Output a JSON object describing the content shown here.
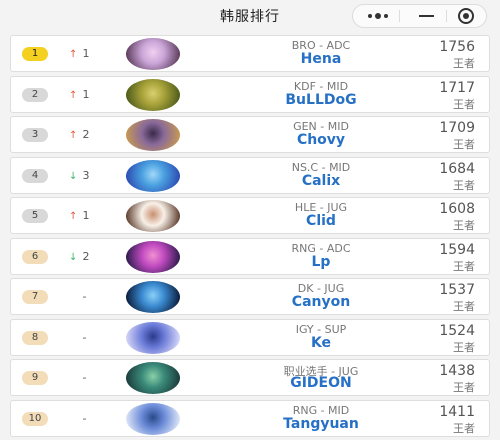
{
  "header": {
    "title": "韩服排行",
    "more_icon": "more-dots-icon",
    "minimize_icon": "minimize-icon",
    "close_icon": "target-close-icon"
  },
  "rows": [
    {
      "rank": "1",
      "rank_style": "gold",
      "trend": "up",
      "trend_value": "1",
      "team_role": "BRO - ADC",
      "name": "Hena",
      "score": "1756",
      "tier": "王者",
      "avatar_colors": [
        "#caa6d8",
        "#5a3a5a",
        "#f0d0f0"
      ]
    },
    {
      "rank": "2",
      "rank_style": "silver",
      "trend": "up",
      "trend_value": "1",
      "team_role": "KDF - MID",
      "name": "BuLLDoG",
      "score": "1717",
      "tier": "王者",
      "avatar_colors": [
        "#a8a23a",
        "#4b5a1a",
        "#d8d070"
      ]
    },
    {
      "rank": "3",
      "rank_style": "silver",
      "trend": "up",
      "trend_value": "2",
      "team_role": "GEN - MID",
      "name": "Chovy",
      "score": "1709",
      "tier": "王者",
      "avatar_colors": [
        "#8a6a9a",
        "#c89a50",
        "#3a2a4a"
      ]
    },
    {
      "rank": "4",
      "rank_style": "silver",
      "trend": "down",
      "trend_value": "3",
      "team_role": "NS.C - MID",
      "name": "Calix",
      "score": "1684",
      "tier": "王者",
      "avatar_colors": [
        "#4aa0e0",
        "#2a4ab0",
        "#a0d8f8"
      ]
    },
    {
      "rank": "5",
      "rank_style": "silver",
      "trend": "up",
      "trend_value": "1",
      "team_role": "HLE - JUG",
      "name": "Clid",
      "score": "1608",
      "tier": "王者",
      "avatar_colors": [
        "#f8f0e8",
        "#5a3a2a",
        "#c89070"
      ]
    },
    {
      "rank": "6",
      "rank_style": "bronze",
      "trend": "down",
      "trend_value": "2",
      "team_role": "RNG - ADC",
      "name": "Lp",
      "score": "1594",
      "tier": "王者",
      "avatar_colors": [
        "#c04ac0",
        "#2a1a4a",
        "#f090d0"
      ]
    },
    {
      "rank": "7",
      "rank_style": "bronze",
      "trend": "none",
      "trend_value": "-",
      "team_role": "DK - JUG",
      "name": "Canyon",
      "score": "1537",
      "tier": "王者",
      "avatar_colors": [
        "#3a8ad0",
        "#0a1a3a",
        "#8ad0f8"
      ]
    },
    {
      "rank": "8",
      "rank_style": "bronze",
      "trend": "none",
      "trend_value": "-",
      "team_role": "IGY - SUP",
      "name": "Ke",
      "score": "1524",
      "tier": "王者",
      "avatar_colors": [
        "#6a7ad8",
        "#d8d8f8",
        "#2a3a8a"
      ]
    },
    {
      "rank": "9",
      "rank_style": "bronze",
      "trend": "none",
      "trend_value": "-",
      "team_role": "职业选手 - JUG",
      "name": "GIDEON",
      "score": "1438",
      "tier": "王者",
      "avatar_colors": [
        "#3a8a7a",
        "#1a3a3a",
        "#8ad0a8"
      ]
    },
    {
      "rank": "10",
      "rank_style": "bronze",
      "trend": "none",
      "trend_value": "-",
      "team_role": "RNG - MID",
      "name": "Tangyuan",
      "score": "1411",
      "tier": "王者",
      "avatar_colors": [
        "#6a8ad8",
        "#e0e8f8",
        "#2a4a8a"
      ]
    }
  ]
}
